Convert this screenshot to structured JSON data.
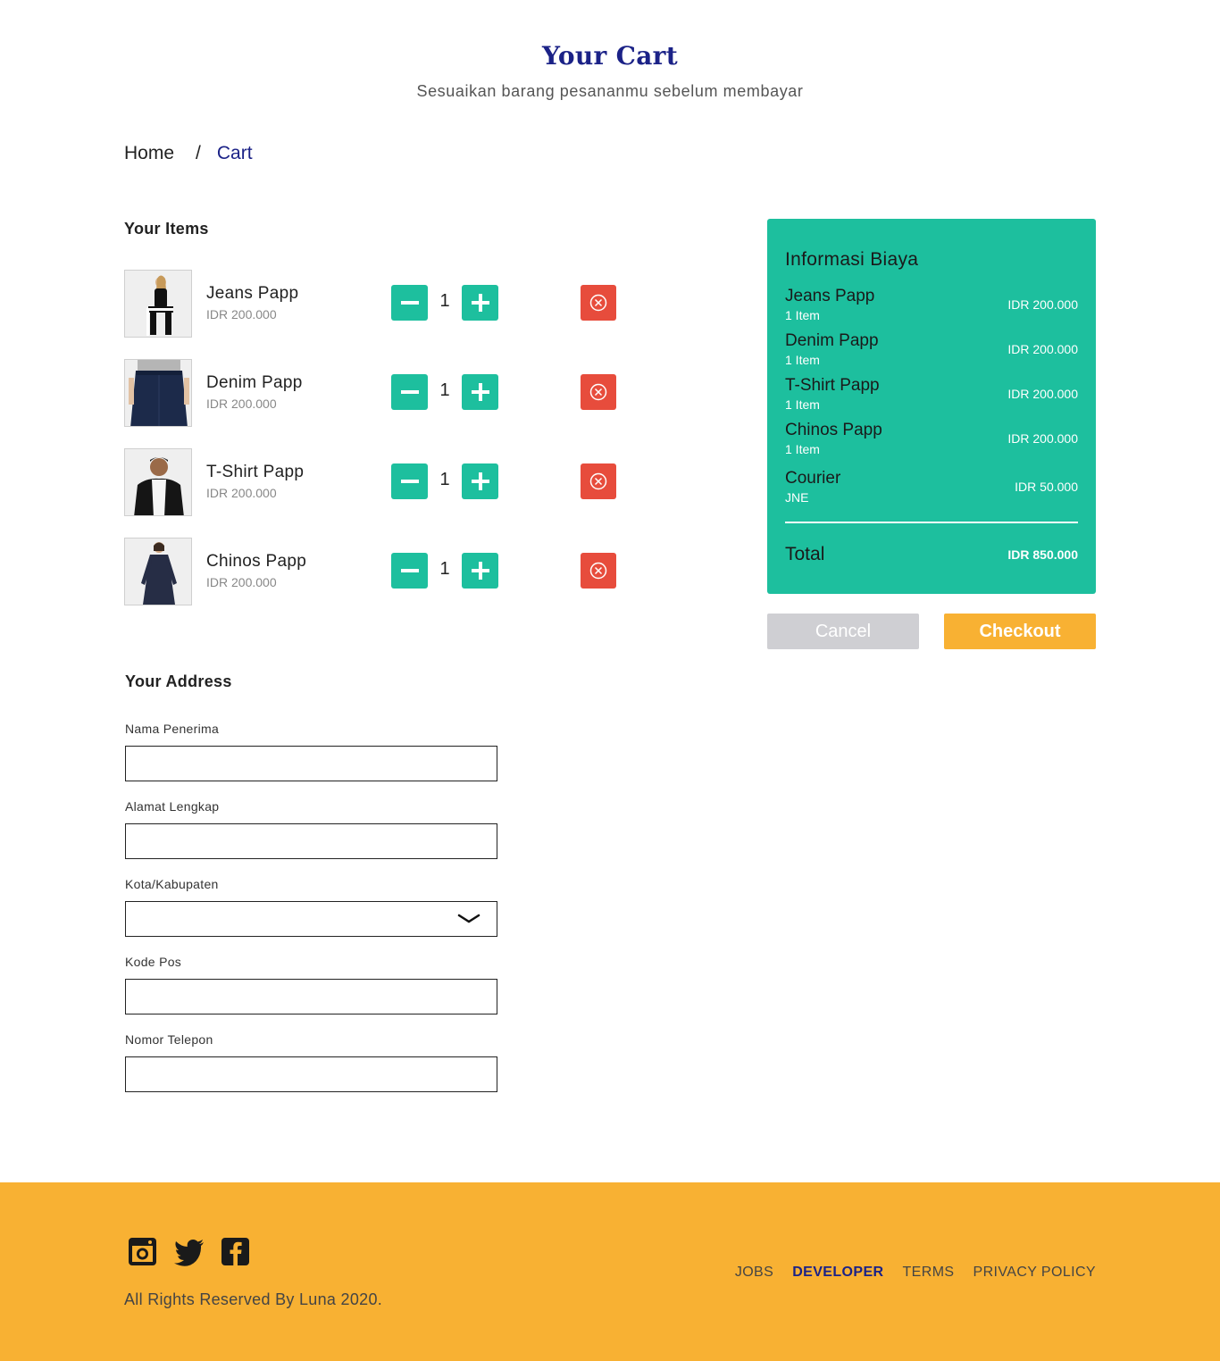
{
  "header": {
    "title": "Your Cart",
    "subtitle": "Sesuaikan barang pesananmu sebelum membayar"
  },
  "breadcrumb": {
    "home": "Home",
    "separator": "/",
    "current": "Cart"
  },
  "items_section": {
    "heading": "Your Items",
    "items": [
      {
        "name": "Jeans Papp",
        "price": "IDR 200.000",
        "qty": "1",
        "image": "woman-black-outfit"
      },
      {
        "name": "Denim Papp",
        "price": "IDR 200.000",
        "qty": "1",
        "image": "denim-skirt"
      },
      {
        "name": "T-Shirt Papp",
        "price": "IDR 200.000",
        "qty": "1",
        "image": "man-black-jacket"
      },
      {
        "name": "Chinos Papp",
        "price": "IDR 200.000",
        "qty": "1",
        "image": "woman-navy-dress"
      }
    ]
  },
  "summary": {
    "title": "Informasi Biaya",
    "rows": [
      {
        "name": "Jeans Papp",
        "detail": "1 Item",
        "price": "IDR 200.000"
      },
      {
        "name": "Denim Papp",
        "detail": "1 Item",
        "price": "IDR 200.000"
      },
      {
        "name": "T-Shirt Papp",
        "detail": "1 Item",
        "price": "IDR 200.000"
      },
      {
        "name": "Chinos Papp",
        "detail": "1 Item",
        "price": "IDR 200.000"
      },
      {
        "name": "Courier",
        "detail": "JNE",
        "price": "IDR 50.000"
      }
    ],
    "total_label": "Total",
    "total_value": "IDR 850.000",
    "cancel_label": "Cancel",
    "checkout_label": "Checkout"
  },
  "address": {
    "heading": "Your Address",
    "fields": {
      "name": {
        "label": "Nama Penerima",
        "value": ""
      },
      "address": {
        "label": "Alamat Lengkap",
        "value": ""
      },
      "city": {
        "label": "Kota/Kabupaten",
        "value": ""
      },
      "postal": {
        "label": "Kode Pos",
        "value": ""
      },
      "phone": {
        "label": "Nomor Telepon",
        "value": ""
      }
    }
  },
  "footer": {
    "social": [
      "instagram-icon",
      "twitter-icon",
      "facebook-icon"
    ],
    "copyright": "All Rights Reserved By Luna 2020.",
    "links": [
      "JOBS",
      "DEVELOPER",
      "TERMS",
      "PRIVACY POLICY"
    ],
    "active_link": "DEVELOPER"
  },
  "colors": {
    "primary": "#1b2287",
    "accent_green": "#1dbf9e",
    "danger": "#e74c3c",
    "footer_bg": "#f8b133",
    "cancel_bg": "#cfcfd3"
  }
}
